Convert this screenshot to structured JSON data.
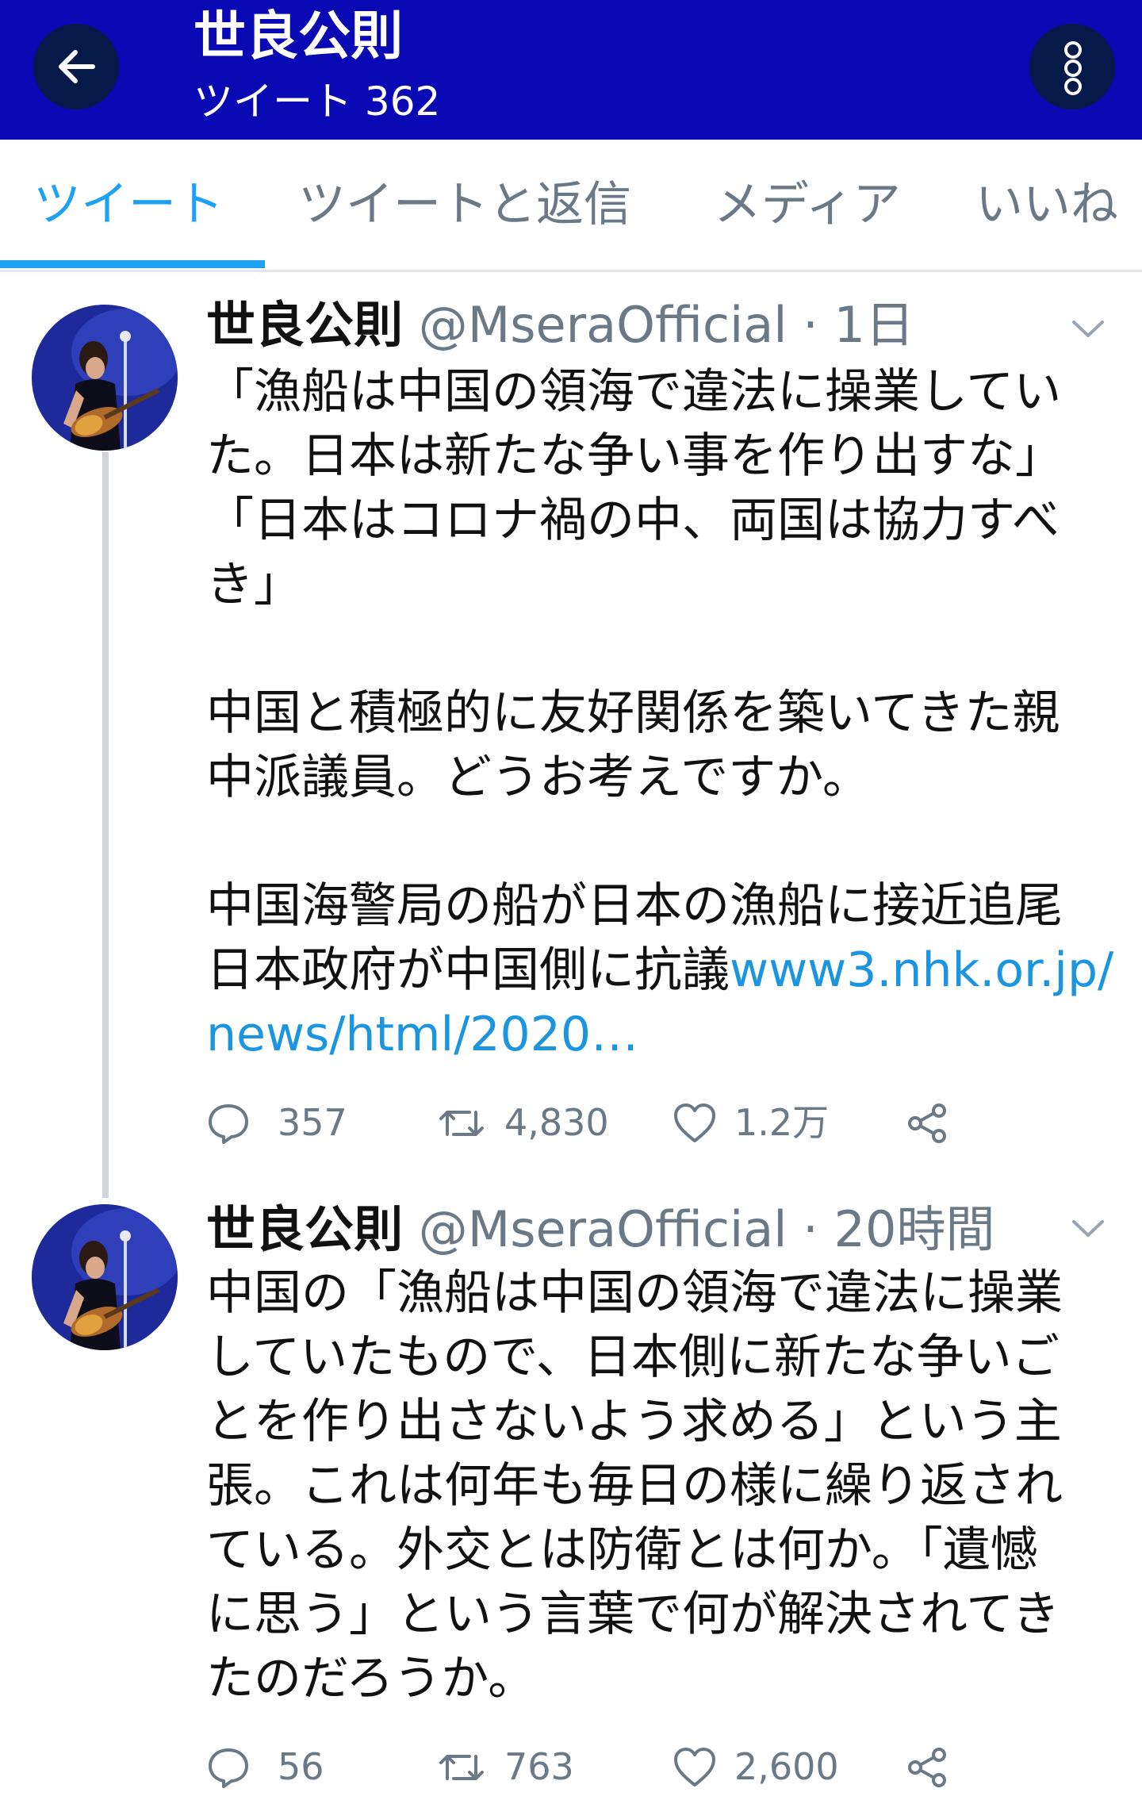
{
  "header": {
    "title": "世良公則",
    "subtitle": "ツイート 362",
    "back_icon": "arrow-left-icon",
    "more_icon": "more-vertical-icon",
    "background_color": "#0a0ab4"
  },
  "tabs": [
    {
      "label": "ツイート",
      "active": true
    },
    {
      "label": "ツイートと返信",
      "active": false
    },
    {
      "label": "メディア",
      "active": false
    },
    {
      "label": "いいね",
      "active": false
    }
  ],
  "accent_color": "#1da1f2",
  "tweets": [
    {
      "name": "世良公則",
      "handle_time": "@MseraOfficial · 1日",
      "lines": [
        "「漁船は中国の領海で違法に操業してい",
        "た。日本は新たな争い事を作り出すな」",
        "「日本はコロナ禍の中、両国は協力すべ",
        "き」",
        "",
        "中国と積極的に友好関係を築いてきた親",
        "中派議員。どうお考えですか。",
        "",
        "中国海警局の船が日本の漁船に接近追尾",
        "日本政府が中国側に抗議"
      ],
      "link_part1": "www3.nhk.or.jp/",
      "link_part2": "news/html/2020…",
      "replies": "357",
      "retweets": "4,830",
      "likes": "1.2万"
    },
    {
      "name": "世良公則",
      "handle_time": "@MseraOfficial · 20時間",
      "lines": [
        "中国の「漁船は中国の領海で違法に操業",
        "していたもので、日本側に新たな争いご",
        "とを作り出さないよう求める」という主",
        "張。これは何年も毎日の様に繰り返され",
        "ている。外交とは防衛とは何か。「遺憾",
        "に思う」という言葉で何が解決されてき",
        "たのだろうか。"
      ],
      "replies": "56",
      "retweets": "763",
      "likes": "2,600"
    }
  ]
}
